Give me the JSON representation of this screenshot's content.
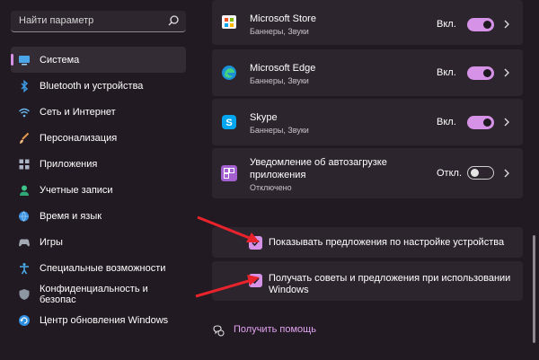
{
  "search": {
    "placeholder": "Найти параметр",
    "icon": "search-icon"
  },
  "sidebar": {
    "items": [
      {
        "label": "Система",
        "icon": "monitor-icon",
        "active": true
      },
      {
        "label": "Bluetooth и устройства",
        "icon": "bluetooth-icon"
      },
      {
        "label": "Сеть и Интернет",
        "icon": "wifi-icon"
      },
      {
        "label": "Персонализация",
        "icon": "brush-icon"
      },
      {
        "label": "Приложения",
        "icon": "apps-icon"
      },
      {
        "label": "Учетные записи",
        "icon": "person-icon"
      },
      {
        "label": "Время и язык",
        "icon": "globe-clock-icon"
      },
      {
        "label": "Игры",
        "icon": "gamepad-icon"
      },
      {
        "label": "Специальные возможности",
        "icon": "accessibility-icon"
      },
      {
        "label": "Конфиденциальность и безопас",
        "icon": "shield-icon"
      },
      {
        "label": "Центр обновления Windows",
        "icon": "update-icon"
      }
    ]
  },
  "notifications": {
    "apps": [
      {
        "name": "Microsoft Store",
        "subtitle": "Баннеры, Звуки",
        "state": "Вкл.",
        "on": true,
        "icon": "store-icon"
      },
      {
        "name": "Microsoft Edge",
        "subtitle": "Баннеры, Звуки",
        "state": "Вкл.",
        "on": true,
        "icon": "edge-icon"
      },
      {
        "name": "Skype",
        "subtitle": "Баннеры, Звуки",
        "state": "Вкл.",
        "on": true,
        "icon": "skype-icon"
      },
      {
        "name_line1": "Уведомление об автозагрузке",
        "name_line2": "приложения",
        "subtitle": "Отключено",
        "state": "Откл.",
        "on": false,
        "icon": "startup-app-icon"
      }
    ]
  },
  "options": {
    "show_suggestions": {
      "label": "Показывать предложения по настройке устройства",
      "checked": true
    },
    "get_tips": {
      "label_line1": "Получать советы и предложения при использовании",
      "label_line2": "Windows",
      "checked": true
    }
  },
  "help": {
    "label": "Получить помощь",
    "icon": "help-icon"
  },
  "colors": {
    "accent": "#d592e6",
    "background": "#221a22",
    "card": "#2d252e",
    "annotation_arrow": "#e8232b"
  }
}
